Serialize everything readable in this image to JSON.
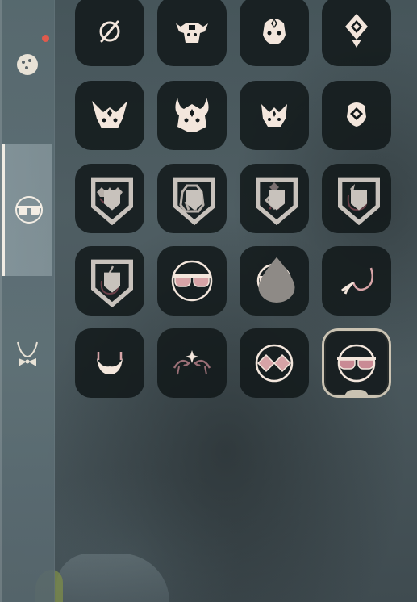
{
  "sidebar": {
    "tabs": [
      {
        "name": "face-tab",
        "icon": "face-icon",
        "selected": false,
        "has_notification": true
      },
      {
        "name": "glasses-tab",
        "icon": "glasses-icon",
        "selected": true,
        "has_notification": false
      },
      {
        "name": "neckwear-tab",
        "icon": "bowtie-icon",
        "selected": false,
        "has_notification": false
      }
    ]
  },
  "grid": {
    "items": [
      {
        "icon": "none-icon",
        "locked": false,
        "selected": false
      },
      {
        "icon": "bull-mask-icon",
        "locked": false,
        "selected": false
      },
      {
        "icon": "ornate-mask-icon",
        "locked": false,
        "selected": false
      },
      {
        "icon": "diamond-crest-mask-icon",
        "locked": false,
        "selected": false
      },
      {
        "icon": "horned-fox-mask-icon",
        "locked": false,
        "selected": false
      },
      {
        "icon": "horned-demon-mask-icon",
        "locked": false,
        "selected": false
      },
      {
        "icon": "small-fox-mask-icon",
        "locked": false,
        "selected": false
      },
      {
        "icon": "emblem-mask-icon",
        "locked": false,
        "selected": false
      },
      {
        "icon": "crowned-mask-icon",
        "locked": true,
        "selected": false
      },
      {
        "icon": "helmet-mask-icon",
        "locked": true,
        "selected": false
      },
      {
        "icon": "diamond-mask-icon",
        "locked": true,
        "selected": false
      },
      {
        "icon": "spirit-mask-icon",
        "locked": true,
        "selected": false
      },
      {
        "icon": "lightning-spirit-mask-icon",
        "locked": true,
        "selected": false
      },
      {
        "icon": "tinted-sunglasses-icon",
        "locked": false,
        "selected": false
      },
      {
        "icon": "round-glasses-icon",
        "locked": false,
        "selected": false,
        "droplet_badge": true
      },
      {
        "icon": "mustache-icon",
        "locked": false,
        "selected": false
      },
      {
        "icon": "beard-icon",
        "locked": false,
        "selected": false
      },
      {
        "icon": "curled-brows-icon",
        "locked": false,
        "selected": false
      },
      {
        "icon": "diamond-glasses-icon",
        "locked": false,
        "selected": false
      },
      {
        "icon": "pink-sunglasses-icon",
        "locked": false,
        "selected": true
      }
    ]
  },
  "colors": {
    "icon_light": "#f3e6dc",
    "icon_pink": "#d6a3a6",
    "icon_dim": "#6a3f48",
    "cell_bg": "#12181a",
    "selected_border": "#c9c2b2",
    "notification": "#e05a4c"
  }
}
